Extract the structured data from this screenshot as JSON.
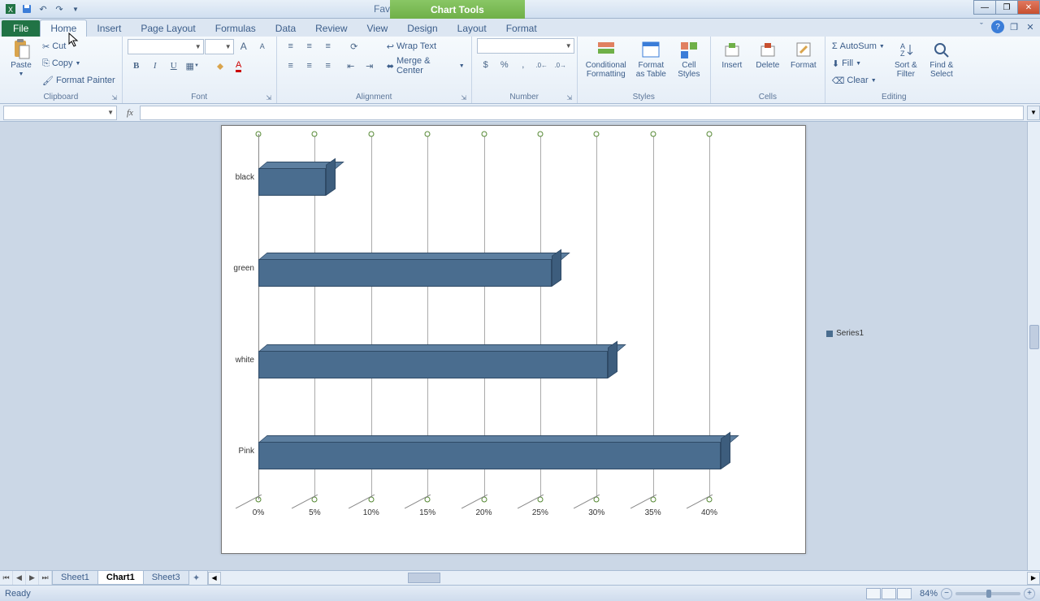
{
  "titlebar": {
    "doc_title": "Favorite colors - Microsoft Excel",
    "chart_tools": "Chart Tools"
  },
  "tabs": {
    "file": "File",
    "home": "Home",
    "insert": "Insert",
    "page_layout": "Page Layout",
    "formulas": "Formulas",
    "data": "Data",
    "review": "Review",
    "view": "View",
    "design": "Design",
    "layout": "Layout",
    "format": "Format"
  },
  "ribbon": {
    "clipboard": {
      "label": "Clipboard",
      "paste": "Paste",
      "cut": "Cut",
      "copy": "Copy",
      "format_painter": "Format Painter"
    },
    "font": {
      "label": "Font"
    },
    "alignment": {
      "label": "Alignment",
      "wrap": "Wrap Text",
      "merge": "Merge & Center"
    },
    "number": {
      "label": "Number"
    },
    "styles": {
      "label": "Styles",
      "conditional": "Conditional\nFormatting",
      "table": "Format\nas Table",
      "cell": "Cell\nStyles"
    },
    "cells": {
      "label": "Cells",
      "insert": "Insert",
      "delete": "Delete",
      "format": "Format"
    },
    "editing": {
      "label": "Editing",
      "sum": "AutoSum",
      "fill": "Fill",
      "clear": "Clear",
      "sort": "Sort &\nFilter",
      "find": "Find &\nSelect"
    }
  },
  "chart_data": {
    "type": "bar",
    "orientation": "horizontal",
    "series_name": "Series1",
    "categories": [
      "black",
      "green",
      "white",
      "Pink"
    ],
    "values": [
      6,
      26,
      31,
      41
    ],
    "xlabel": "",
    "ylabel": "",
    "xlim": [
      0,
      40
    ],
    "x_ticks": [
      "0%",
      "5%",
      "10%",
      "15%",
      "20%",
      "25%",
      "30%",
      "35%",
      "40%"
    ]
  },
  "sheets": {
    "s1": "Sheet1",
    "s2": "Chart1",
    "s3": "Sheet3"
  },
  "statusbar": {
    "ready": "Ready",
    "zoom": "84%"
  }
}
